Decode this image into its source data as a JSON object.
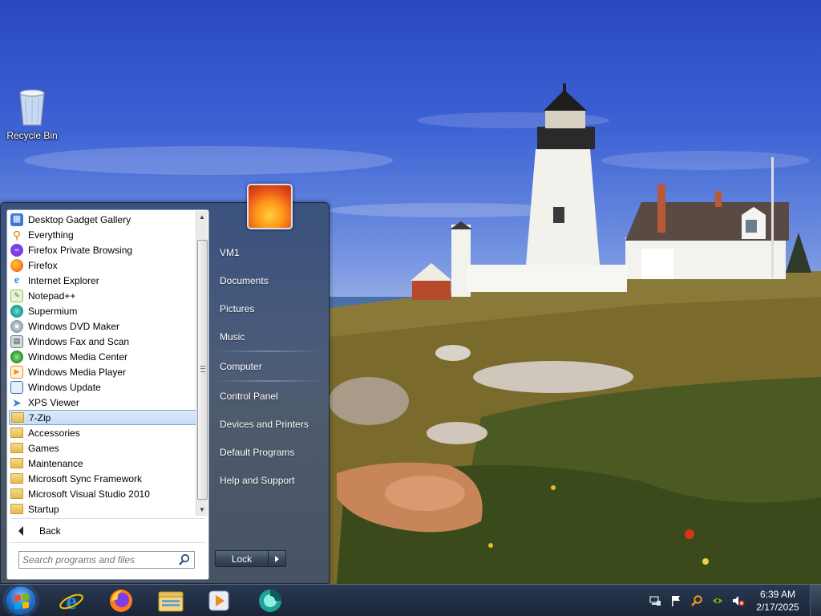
{
  "desktop": {
    "icons": [
      {
        "label": "Recycle Bin",
        "icon": "recycle-bin-icon"
      }
    ]
  },
  "start_menu": {
    "programs": [
      {
        "label": "Desktop Gadget Gallery",
        "icon": "gadget-gallery-icon",
        "color": "#3a7bd5"
      },
      {
        "label": "Everything",
        "icon": "everything-icon",
        "color": "#e07b10"
      },
      {
        "label": "Firefox Private Browsing",
        "icon": "firefox-private-icon",
        "color": "#7b3fe4"
      },
      {
        "label": "Firefox",
        "icon": "firefox-icon",
        "color": "#ff7a1a"
      },
      {
        "label": "Internet Explorer",
        "icon": "internet-explorer-icon",
        "color": "#2a8ae0"
      },
      {
        "label": "Notepad++",
        "icon": "notepad-plus-plus-icon",
        "color": "#8bc34a"
      },
      {
        "label": "Supermium",
        "icon": "supermium-icon",
        "color": "#1aa39a"
      },
      {
        "label": "Windows DVD Maker",
        "icon": "dvd-maker-icon",
        "color": "#5f6b7a"
      },
      {
        "label": "Windows Fax and Scan",
        "icon": "fax-scan-icon",
        "color": "#6d7a8a"
      },
      {
        "label": "Windows Media Center",
        "icon": "media-center-icon",
        "color": "#2e9e3a"
      },
      {
        "label": "Windows Media Player",
        "icon": "media-player-icon",
        "color": "#f08a1a"
      },
      {
        "label": "Windows Update",
        "icon": "windows-update-icon",
        "color": "#2f6fc0"
      },
      {
        "label": "XPS Viewer",
        "icon": "xps-viewer-icon",
        "color": "#3d82c4"
      }
    ],
    "folders": [
      {
        "label": "7-Zip",
        "selected": true
      },
      {
        "label": "Accessories",
        "selected": false
      },
      {
        "label": "Games",
        "selected": false
      },
      {
        "label": "Maintenance",
        "selected": false
      },
      {
        "label": "Microsoft Sync Framework",
        "selected": false
      },
      {
        "label": "Microsoft Visual Studio 2010",
        "selected": false
      },
      {
        "label": "Startup",
        "selected": false
      }
    ],
    "back_label": "Back",
    "search_placeholder": "Search programs and files",
    "right_items": [
      {
        "label": "VM1"
      },
      {
        "label": "Documents"
      },
      {
        "label": "Pictures"
      },
      {
        "label": "Music"
      },
      {
        "label": "Computer"
      },
      {
        "label": "Control Panel"
      },
      {
        "label": "Devices and Printers"
      },
      {
        "label": "Default Programs"
      },
      {
        "label": "Help and Support"
      }
    ],
    "lock_label": "Lock"
  },
  "taskbar": {
    "pinned": [
      {
        "icon": "internet-explorer-icon"
      },
      {
        "icon": "firefox-icon"
      },
      {
        "icon": "file-explorer-icon"
      },
      {
        "icon": "media-player-icon"
      },
      {
        "icon": "supermium-icon"
      }
    ],
    "tray_icons": [
      "network-icon",
      "action-center-flag-icon",
      "everything-search-icon",
      "nvidia-icon",
      "volume-muted-icon"
    ],
    "clock": {
      "time": "6:39 AM",
      "date": "2/17/2025"
    }
  }
}
